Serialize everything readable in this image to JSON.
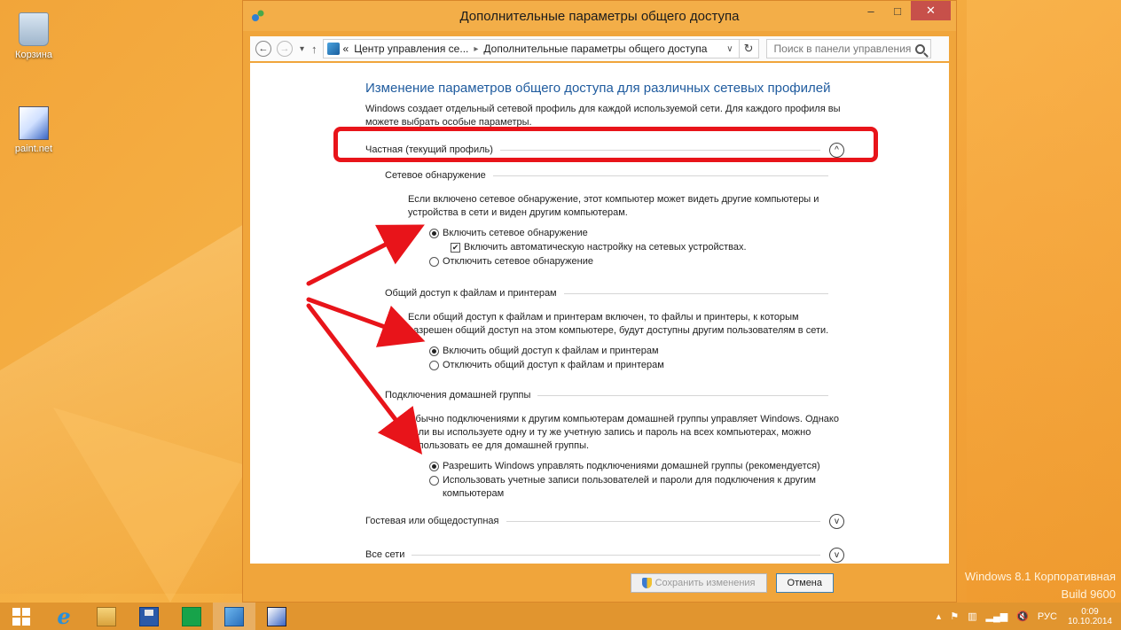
{
  "desktop": {
    "icons": [
      {
        "label": "Корзина"
      },
      {
        "label": "paint.net"
      }
    ],
    "watermark": {
      "line1": "Windows 8.1 Корпоративная",
      "line2": "Build 9600"
    }
  },
  "window": {
    "title": "Дополнительные параметры общего доступа",
    "controls": {
      "minimize": "–",
      "maximize": "□",
      "close": "✕"
    },
    "address": {
      "prefix": "«",
      "crumb1": "Центр управления се...",
      "sep": "▸",
      "crumb2": "Дополнительные параметры общего доступа",
      "dropdown": "∨",
      "refresh": "↻"
    },
    "search_placeholder": "Поиск в панели управления",
    "nav": {
      "back": "←",
      "forward": "→",
      "recent": "▾",
      "up": "↑"
    }
  },
  "content": {
    "title": "Изменение параметров общего доступа для различных сетевых профилей",
    "intro": "Windows создает отдельный сетевой профиль для каждой используемой сети. Для каждого профиля вы можете выбрать особые параметры.",
    "private_profile": {
      "label": "Частная (текущий профиль)",
      "chevron": "^",
      "discovery": {
        "heading": "Сетевое обнаружение",
        "desc": "Если включено сетевое обнаружение, этот компьютер может видеть другие компьютеры и устройства в сети и виден другим компьютерам.",
        "opt_on": "Включить сетевое обнаружение",
        "opt_auto": "Включить автоматическую настройку на сетевых устройствах.",
        "opt_off": "Отключить сетевое обнаружение"
      },
      "sharing": {
        "heading": "Общий доступ к файлам и принтерам",
        "desc": "Если общий доступ к файлам и принтерам включен, то файлы и принтеры, к которым разрешен общий доступ на этом компьютере, будут доступны другим пользователям в сети.",
        "opt_on": "Включить общий доступ к файлам и принтерам",
        "opt_off": "Отключить общий доступ к файлам и принтерам"
      },
      "homegroup": {
        "heading": "Подключения домашней группы",
        "desc": "Обычно подключениями к другим компьютерам домашней группы управляет Windows. Однако если вы используете одну и ту же учетную запись и пароль на всех компьютерах, можно использовать ее для домашней группы.",
        "opt_windows": "Разрешить Windows управлять подключениями домашней группы (рекомендуется)",
        "opt_accounts": "Использовать учетные записи пользователей и пароли для подключения к другим компьютерам"
      }
    },
    "guest_profile": {
      "label": "Гостевая или общедоступная",
      "chevron": "v"
    },
    "all_networks": {
      "label": "Все сети",
      "chevron": "v"
    }
  },
  "footer": {
    "save": "Сохранить изменения",
    "cancel": "Отмена"
  },
  "taskbar": {
    "tray_lang": "РУС",
    "time": "0:09",
    "date": "10.10.2014"
  },
  "colors": {
    "accent": "#f3ae48",
    "annotation": "#e8141a",
    "link_title": "#1f5b9e"
  }
}
